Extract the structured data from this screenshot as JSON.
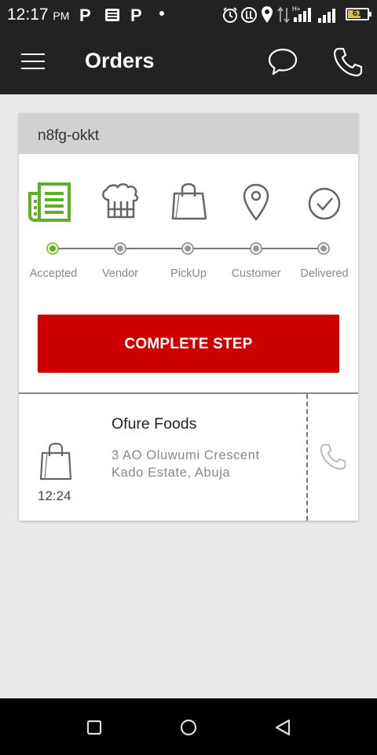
{
  "status_bar": {
    "time": "12:17",
    "ampm": "PM",
    "battery": "61",
    "notification_icons": [
      "parking-icon",
      "news-icon",
      "parking-icon",
      "dot-icon"
    ],
    "system_icons": [
      "alarm-icon",
      "volte-icon",
      "location-icon",
      "data-arrows-icon",
      "signal-icon",
      "signal-icon",
      "battery-icon"
    ]
  },
  "app_bar": {
    "title": "Orders",
    "icons": [
      "menu-icon",
      "chat-icon",
      "phone-icon"
    ]
  },
  "order": {
    "code": "n8fg-okkt",
    "steps": [
      {
        "label": "Accepted",
        "icon": "receipt-icon",
        "active": true
      },
      {
        "label": "Vendor",
        "icon": "chef-hat-icon",
        "active": false
      },
      {
        "label": "PickUp",
        "icon": "shopping-bag-icon",
        "active": false
      },
      {
        "label": "Customer",
        "icon": "location-pin-icon",
        "active": false
      },
      {
        "label": "Delivered",
        "icon": "check-circle-icon",
        "active": false
      }
    ],
    "action_label": "COMPLETE STEP",
    "pickup": {
      "vendor_name": "Ofure Foods",
      "address_line1": "3 AO Oluwumi Crescent",
      "address_line2": "Kado Estate, Abuja",
      "time": "12:24"
    }
  },
  "colors": {
    "app_bar": "#222222",
    "accent_red": "#cc0000",
    "active_green": "#5fb026",
    "background": "#e9e9e9"
  },
  "nav_bar": {
    "buttons": [
      "recents-square-icon",
      "home-circle-icon",
      "back-triangle-icon"
    ]
  }
}
